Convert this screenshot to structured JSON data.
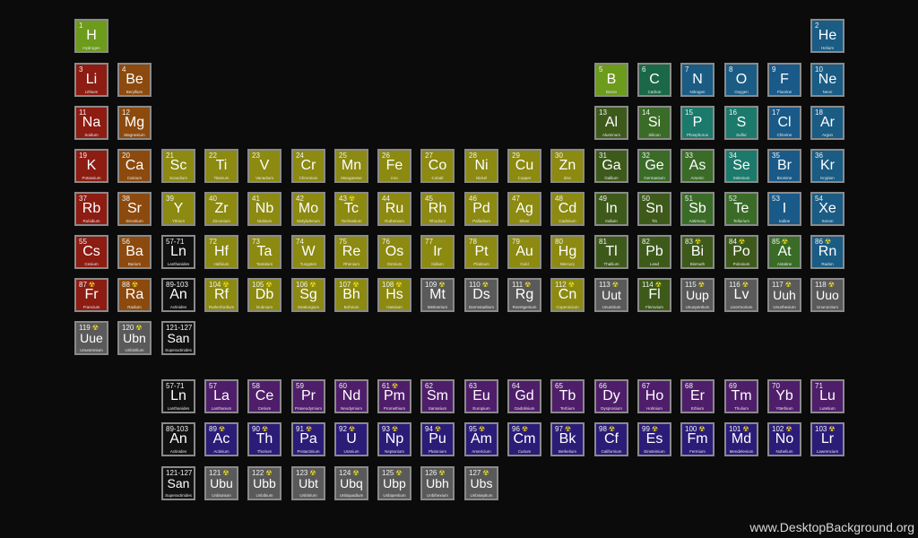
{
  "colors": {
    "nonmetal": "#6d9b1b",
    "alkali": "#8d1c12",
    "alkaline": "#8c4a0e",
    "transition": "#8c8a10",
    "posttransition": "#3e5a1b",
    "metalloid": "#3a6c28",
    "pnictogen": "#1b6848",
    "chalcogen": "#1b7a6b",
    "halogen": "#1a5a88",
    "noble": "#1a5c84",
    "lanthanide": "#4f1e6a",
    "actinide": "#2b1c78",
    "unknown": "#5a5a5a",
    "placeholder": "#111111",
    "radioactive": "#f1e21b"
  },
  "elements": [
    {
      "n": "1",
      "s": "H",
      "name": "Hydrogen",
      "c": "nonmetal",
      "col": 1,
      "row": 1
    },
    {
      "n": "2",
      "s": "He",
      "name": "Helium",
      "c": "noble",
      "col": 18,
      "row": 1
    },
    {
      "n": "3",
      "s": "Li",
      "name": "Lithium",
      "c": "alkali",
      "col": 1,
      "row": 2
    },
    {
      "n": "4",
      "s": "Be",
      "name": "Beryllium",
      "c": "alkaline",
      "col": 2,
      "row": 2
    },
    {
      "n": "5",
      "s": "B",
      "name": "Boron",
      "c": "nonmetal",
      "col": 13,
      "row": 2
    },
    {
      "n": "6",
      "s": "C",
      "name": "Carbon",
      "c": "pnictogen",
      "col": 14,
      "row": 2
    },
    {
      "n": "7",
      "s": "N",
      "name": "Nitrogen",
      "c": "noble",
      "col": 15,
      "row": 2
    },
    {
      "n": "8",
      "s": "O",
      "name": "Oxygen",
      "c": "noble",
      "col": 16,
      "row": 2
    },
    {
      "n": "9",
      "s": "F",
      "name": "Fluorine",
      "c": "halogen",
      "col": 17,
      "row": 2
    },
    {
      "n": "10",
      "s": "Ne",
      "name": "Neon",
      "c": "noble",
      "col": 18,
      "row": 2
    },
    {
      "n": "11",
      "s": "Na",
      "name": "Sodium",
      "c": "alkali",
      "col": 1,
      "row": 3
    },
    {
      "n": "12",
      "s": "Mg",
      "name": "Magnesium",
      "c": "alkaline",
      "col": 2,
      "row": 3
    },
    {
      "n": "13",
      "s": "Al",
      "name": "Aluminum",
      "c": "posttransition",
      "col": 13,
      "row": 3
    },
    {
      "n": "14",
      "s": "Si",
      "name": "Silicon",
      "c": "metalloid",
      "col": 14,
      "row": 3
    },
    {
      "n": "15",
      "s": "P",
      "name": "Phosphorus",
      "c": "chalcogen",
      "col": 15,
      "row": 3
    },
    {
      "n": "16",
      "s": "S",
      "name": "Sulfur",
      "c": "chalcogen",
      "col": 16,
      "row": 3
    },
    {
      "n": "17",
      "s": "Cl",
      "name": "Chlorine",
      "c": "halogen",
      "col": 17,
      "row": 3
    },
    {
      "n": "18",
      "s": "Ar",
      "name": "Argon",
      "c": "noble",
      "col": 18,
      "row": 3
    },
    {
      "n": "19",
      "s": "K",
      "name": "Potassium",
      "c": "alkali",
      "col": 1,
      "row": 4
    },
    {
      "n": "20",
      "s": "Ca",
      "name": "Calcium",
      "c": "alkaline",
      "col": 2,
      "row": 4
    },
    {
      "n": "21",
      "s": "Sc",
      "name": "Scandium",
      "c": "transition",
      "col": 3,
      "row": 4
    },
    {
      "n": "22",
      "s": "Ti",
      "name": "Titanium",
      "c": "transition",
      "col": 4,
      "row": 4
    },
    {
      "n": "23",
      "s": "V",
      "name": "Vanadium",
      "c": "transition",
      "col": 5,
      "row": 4
    },
    {
      "n": "24",
      "s": "Cr",
      "name": "Chromium",
      "c": "transition",
      "col": 6,
      "row": 4
    },
    {
      "n": "25",
      "s": "Mn",
      "name": "Manganese",
      "c": "transition",
      "col": 7,
      "row": 4
    },
    {
      "n": "26",
      "s": "Fe",
      "name": "Iron",
      "c": "transition",
      "col": 8,
      "row": 4
    },
    {
      "n": "27",
      "s": "Co",
      "name": "Cobalt",
      "c": "transition",
      "col": 9,
      "row": 4
    },
    {
      "n": "28",
      "s": "Ni",
      "name": "Nickel",
      "c": "transition",
      "col": 10,
      "row": 4
    },
    {
      "n": "29",
      "s": "Cu",
      "name": "Copper",
      "c": "transition",
      "col": 11,
      "row": 4
    },
    {
      "n": "30",
      "s": "Zn",
      "name": "Zinc",
      "c": "transition",
      "col": 12,
      "row": 4
    },
    {
      "n": "31",
      "s": "Ga",
      "name": "Gallium",
      "c": "posttransition",
      "col": 13,
      "row": 4
    },
    {
      "n": "32",
      "s": "Ge",
      "name": "Germanium",
      "c": "metalloid",
      "col": 14,
      "row": 4
    },
    {
      "n": "33",
      "s": "As",
      "name": "Arsenic",
      "c": "metalloid",
      "col": 15,
      "row": 4
    },
    {
      "n": "34",
      "s": "Se",
      "name": "Selenium",
      "c": "chalcogen",
      "col": 16,
      "row": 4
    },
    {
      "n": "35",
      "s": "Br",
      "name": "Bromine",
      "c": "halogen",
      "col": 17,
      "row": 4
    },
    {
      "n": "36",
      "s": "Kr",
      "name": "Krypton",
      "c": "noble",
      "col": 18,
      "row": 4
    },
    {
      "n": "37",
      "s": "Rb",
      "name": "Rubidium",
      "c": "alkali",
      "col": 1,
      "row": 5
    },
    {
      "n": "38",
      "s": "Sr",
      "name": "Strontium",
      "c": "alkaline",
      "col": 2,
      "row": 5
    },
    {
      "n": "39",
      "s": "Y",
      "name": "Yttrium",
      "c": "transition",
      "col": 3,
      "row": 5
    },
    {
      "n": "40",
      "s": "Zr",
      "name": "Zirconium",
      "c": "transition",
      "col": 4,
      "row": 5
    },
    {
      "n": "41",
      "s": "Nb",
      "name": "Niobium",
      "c": "transition",
      "col": 5,
      "row": 5
    },
    {
      "n": "42",
      "s": "Mo",
      "name": "Molybdenum",
      "c": "transition",
      "col": 6,
      "row": 5
    },
    {
      "n": "43",
      "s": "Tc",
      "name": "Technetium",
      "c": "transition",
      "col": 7,
      "row": 5,
      "rad": true
    },
    {
      "n": "44",
      "s": "Ru",
      "name": "Ruthenium",
      "c": "transition",
      "col": 8,
      "row": 5
    },
    {
      "n": "45",
      "s": "Rh",
      "name": "Rhodium",
      "c": "transition",
      "col": 9,
      "row": 5
    },
    {
      "n": "46",
      "s": "Pd",
      "name": "Palladium",
      "c": "transition",
      "col": 10,
      "row": 5
    },
    {
      "n": "47",
      "s": "Ag",
      "name": "Silver",
      "c": "transition",
      "col": 11,
      "row": 5
    },
    {
      "n": "48",
      "s": "Cd",
      "name": "Cadmium",
      "c": "transition",
      "col": 12,
      "row": 5
    },
    {
      "n": "49",
      "s": "In",
      "name": "Indium",
      "c": "posttransition",
      "col": 13,
      "row": 5
    },
    {
      "n": "50",
      "s": "Sn",
      "name": "Tin",
      "c": "posttransition",
      "col": 14,
      "row": 5
    },
    {
      "n": "51",
      "s": "Sb",
      "name": "Antimony",
      "c": "metalloid",
      "col": 15,
      "row": 5
    },
    {
      "n": "52",
      "s": "Te",
      "name": "Tellurium",
      "c": "metalloid",
      "col": 16,
      "row": 5
    },
    {
      "n": "53",
      "s": "I",
      "name": "Iodine",
      "c": "halogen",
      "col": 17,
      "row": 5
    },
    {
      "n": "54",
      "s": "Xe",
      "name": "Xenon",
      "c": "noble",
      "col": 18,
      "row": 5
    },
    {
      "n": "55",
      "s": "Cs",
      "name": "Cesium",
      "c": "alkali",
      "col": 1,
      "row": 6
    },
    {
      "n": "56",
      "s": "Ba",
      "name": "Barium",
      "c": "alkaline",
      "col": 2,
      "row": 6
    },
    {
      "n": "57-71",
      "s": "Ln",
      "name": "Lanthanides",
      "c": "placeholder",
      "col": 3,
      "row": 6
    },
    {
      "n": "72",
      "s": "Hf",
      "name": "Hafnium",
      "c": "transition",
      "col": 4,
      "row": 6
    },
    {
      "n": "73",
      "s": "Ta",
      "name": "Tantalum",
      "c": "transition",
      "col": 5,
      "row": 6
    },
    {
      "n": "74",
      "s": "W",
      "name": "Tungsten",
      "c": "transition",
      "col": 6,
      "row": 6
    },
    {
      "n": "75",
      "s": "Re",
      "name": "Rhenium",
      "c": "transition",
      "col": 7,
      "row": 6
    },
    {
      "n": "76",
      "s": "Os",
      "name": "Osmium",
      "c": "transition",
      "col": 8,
      "row": 6
    },
    {
      "n": "77",
      "s": "Ir",
      "name": "Iridium",
      "c": "transition",
      "col": 9,
      "row": 6
    },
    {
      "n": "78",
      "s": "Pt",
      "name": "Platinum",
      "c": "transition",
      "col": 10,
      "row": 6
    },
    {
      "n": "79",
      "s": "Au",
      "name": "Gold",
      "c": "transition",
      "col": 11,
      "row": 6
    },
    {
      "n": "80",
      "s": "Hg",
      "name": "Mercury",
      "c": "transition",
      "col": 12,
      "row": 6
    },
    {
      "n": "81",
      "s": "Tl",
      "name": "Thallium",
      "c": "posttransition",
      "col": 13,
      "row": 6
    },
    {
      "n": "82",
      "s": "Pb",
      "name": "Lead",
      "c": "posttransition",
      "col": 14,
      "row": 6
    },
    {
      "n": "83",
      "s": "Bi",
      "name": "Bismuth",
      "c": "posttransition",
      "col": 15,
      "row": 6,
      "rad": true
    },
    {
      "n": "84",
      "s": "Po",
      "name": "Polonium",
      "c": "posttransition",
      "col": 16,
      "row": 6,
      "rad": true
    },
    {
      "n": "85",
      "s": "At",
      "name": "Astatine",
      "c": "metalloid",
      "col": 17,
      "row": 6,
      "rad": true
    },
    {
      "n": "86",
      "s": "Rn",
      "name": "Radon",
      "c": "noble",
      "col": 18,
      "row": 6,
      "rad": true
    },
    {
      "n": "87",
      "s": "Fr",
      "name": "Francium",
      "c": "alkali",
      "col": 1,
      "row": 7,
      "rad": true
    },
    {
      "n": "88",
      "s": "Ra",
      "name": "Radium",
      "c": "alkaline",
      "col": 2,
      "row": 7,
      "rad": true
    },
    {
      "n": "89-103",
      "s": "An",
      "name": "Actinides",
      "c": "placeholder",
      "col": 3,
      "row": 7
    },
    {
      "n": "104",
      "s": "Rf",
      "name": "Rutherfordium",
      "c": "transition",
      "col": 4,
      "row": 7,
      "rad": true
    },
    {
      "n": "105",
      "s": "Db",
      "name": "Dubnium",
      "c": "transition",
      "col": 5,
      "row": 7,
      "rad": true
    },
    {
      "n": "106",
      "s": "Sg",
      "name": "Seaborgium",
      "c": "transition",
      "col": 6,
      "row": 7,
      "rad": true
    },
    {
      "n": "107",
      "s": "Bh",
      "name": "Bohrium",
      "c": "transition",
      "col": 7,
      "row": 7,
      "rad": true
    },
    {
      "n": "108",
      "s": "Hs",
      "name": "Hassium",
      "c": "transition",
      "col": 8,
      "row": 7,
      "rad": true
    },
    {
      "n": "109",
      "s": "Mt",
      "name": "Meitnerium",
      "c": "unknown",
      "col": 9,
      "row": 7,
      "rad": true
    },
    {
      "n": "110",
      "s": "Ds",
      "name": "Darmstadtium",
      "c": "unknown",
      "col": 10,
      "row": 7,
      "rad": true
    },
    {
      "n": "111",
      "s": "Rg",
      "name": "Roentgenium",
      "c": "unknown",
      "col": 11,
      "row": 7,
      "rad": true
    },
    {
      "n": "112",
      "s": "Cn",
      "name": "Copernicium",
      "c": "transition",
      "col": 12,
      "row": 7,
      "rad": true
    },
    {
      "n": "113",
      "s": "Uut",
      "name": "Ununtrium",
      "c": "unknown",
      "col": 13,
      "row": 7,
      "rad": true
    },
    {
      "n": "114",
      "s": "Fl",
      "name": "Flerovium",
      "c": "posttransition",
      "col": 14,
      "row": 7,
      "rad": true
    },
    {
      "n": "115",
      "s": "Uup",
      "name": "Ununpentium",
      "c": "unknown",
      "col": 15,
      "row": 7,
      "rad": true
    },
    {
      "n": "116",
      "s": "Lv",
      "name": "Livermorium",
      "c": "unknown",
      "col": 16,
      "row": 7,
      "rad": true
    },
    {
      "n": "117",
      "s": "Uuh",
      "name": "Ununhexium",
      "c": "unknown",
      "col": 17,
      "row": 7,
      "rad": true
    },
    {
      "n": "118",
      "s": "Uuo",
      "name": "Ununoctium",
      "c": "unknown",
      "col": 18,
      "row": 7,
      "rad": true
    },
    {
      "n": "119",
      "s": "Uue",
      "name": "Ununennium",
      "c": "unknown",
      "col": 1,
      "row": 8,
      "rad": true
    },
    {
      "n": "120",
      "s": "Ubn",
      "name": "Unbinilium",
      "c": "unknown",
      "col": 2,
      "row": 8,
      "rad": true
    },
    {
      "n": "121-127",
      "s": "San",
      "name": "Superactinides",
      "c": "placeholder",
      "col": 3,
      "row": 8
    },
    {
      "n": "57-71",
      "s": "Ln",
      "name": "Lanthanides",
      "c": "placeholder",
      "col": 3,
      "row": 10
    },
    {
      "n": "57",
      "s": "La",
      "name": "Lanthanum",
      "c": "lanthanide",
      "col": 4,
      "row": 10
    },
    {
      "n": "58",
      "s": "Ce",
      "name": "Cerium",
      "c": "lanthanide",
      "col": 5,
      "row": 10
    },
    {
      "n": "59",
      "s": "Pr",
      "name": "Praseodymium",
      "c": "lanthanide",
      "col": 6,
      "row": 10
    },
    {
      "n": "60",
      "s": "Nd",
      "name": "Neodymium",
      "c": "lanthanide",
      "col": 7,
      "row": 10
    },
    {
      "n": "61",
      "s": "Pm",
      "name": "Promethium",
      "c": "lanthanide",
      "col": 8,
      "row": 10,
      "rad": true
    },
    {
      "n": "62",
      "s": "Sm",
      "name": "Samarium",
      "c": "lanthanide",
      "col": 9,
      "row": 10
    },
    {
      "n": "63",
      "s": "Eu",
      "name": "Europium",
      "c": "lanthanide",
      "col": 10,
      "row": 10
    },
    {
      "n": "64",
      "s": "Gd",
      "name": "Gadolinium",
      "c": "lanthanide",
      "col": 11,
      "row": 10
    },
    {
      "n": "65",
      "s": "Tb",
      "name": "Terbium",
      "c": "lanthanide",
      "col": 12,
      "row": 10
    },
    {
      "n": "66",
      "s": "Dy",
      "name": "Dysprosium",
      "c": "lanthanide",
      "col": 13,
      "row": 10
    },
    {
      "n": "67",
      "s": "Ho",
      "name": "Holmium",
      "c": "lanthanide",
      "col": 14,
      "row": 10
    },
    {
      "n": "68",
      "s": "Er",
      "name": "Erbium",
      "c": "lanthanide",
      "col": 15,
      "row": 10
    },
    {
      "n": "69",
      "s": "Tm",
      "name": "Thulium",
      "c": "lanthanide",
      "col": 16,
      "row": 10
    },
    {
      "n": "70",
      "s": "Yb",
      "name": "Ytterbium",
      "c": "lanthanide",
      "col": 17,
      "row": 10
    },
    {
      "n": "71",
      "s": "Lu",
      "name": "Lutetium",
      "c": "lanthanide",
      "col": 18,
      "row": 10
    },
    {
      "n": "89-103",
      "s": "An",
      "name": "Actinides",
      "c": "placeholder",
      "col": 3,
      "row": 11
    },
    {
      "n": "89",
      "s": "Ac",
      "name": "Actinium",
      "c": "actinide",
      "col": 4,
      "row": 11,
      "rad": true
    },
    {
      "n": "90",
      "s": "Th",
      "name": "Thorium",
      "c": "actinide",
      "col": 5,
      "row": 11,
      "rad": true
    },
    {
      "n": "91",
      "s": "Pa",
      "name": "Protactinium",
      "c": "actinide",
      "col": 6,
      "row": 11,
      "rad": true
    },
    {
      "n": "92",
      "s": "U",
      "name": "Uranium",
      "c": "actinide",
      "col": 7,
      "row": 11,
      "rad": true
    },
    {
      "n": "93",
      "s": "Np",
      "name": "Neptunium",
      "c": "actinide",
      "col": 8,
      "row": 11,
      "rad": true
    },
    {
      "n": "94",
      "s": "Pu",
      "name": "Plutonium",
      "c": "actinide",
      "col": 9,
      "row": 11,
      "rad": true
    },
    {
      "n": "95",
      "s": "Am",
      "name": "Americium",
      "c": "actinide",
      "col": 10,
      "row": 11,
      "rad": true
    },
    {
      "n": "96",
      "s": "Cm",
      "name": "Curium",
      "c": "actinide",
      "col": 11,
      "row": 11,
      "rad": true
    },
    {
      "n": "97",
      "s": "Bk",
      "name": "Berkelium",
      "c": "actinide",
      "col": 12,
      "row": 11,
      "rad": true
    },
    {
      "n": "98",
      "s": "Cf",
      "name": "Californium",
      "c": "actinide",
      "col": 13,
      "row": 11,
      "rad": true
    },
    {
      "n": "99",
      "s": "Es",
      "name": "Einsteinium",
      "c": "actinide",
      "col": 14,
      "row": 11,
      "rad": true
    },
    {
      "n": "100",
      "s": "Fm",
      "name": "Fermium",
      "c": "actinide",
      "col": 15,
      "row": 11,
      "rad": true
    },
    {
      "n": "101",
      "s": "Md",
      "name": "Mendelevium",
      "c": "actinide",
      "col": 16,
      "row": 11,
      "rad": true
    },
    {
      "n": "102",
      "s": "No",
      "name": "Nobelium",
      "c": "actinide",
      "col": 17,
      "row": 11,
      "rad": true
    },
    {
      "n": "103",
      "s": "Lr",
      "name": "Lawrencium",
      "c": "actinide",
      "col": 18,
      "row": 11,
      "rad": true
    },
    {
      "n": "121-127",
      "s": "San",
      "name": "Superactinides",
      "c": "placeholder",
      "col": 3,
      "row": 12
    },
    {
      "n": "121",
      "s": "Ubu",
      "name": "Unbiunium",
      "c": "unknown",
      "col": 4,
      "row": 12,
      "rad": true
    },
    {
      "n": "122",
      "s": "Ubb",
      "name": "Unbibium",
      "c": "unknown",
      "col": 5,
      "row": 12,
      "rad": true
    },
    {
      "n": "123",
      "s": "Ubt",
      "name": "Unbitrium",
      "c": "unknown",
      "col": 6,
      "row": 12,
      "rad": true
    },
    {
      "n": "124",
      "s": "Ubq",
      "name": "Unbiquadium",
      "c": "unknown",
      "col": 7,
      "row": 12,
      "rad": true
    },
    {
      "n": "125",
      "s": "Ubp",
      "name": "Unbipentium",
      "c": "unknown",
      "col": 8,
      "row": 12,
      "rad": true
    },
    {
      "n": "126",
      "s": "Ubh",
      "name": "Unbihexium",
      "c": "unknown",
      "col": 9,
      "row": 12,
      "rad": true
    },
    {
      "n": "127",
      "s": "Ubs",
      "name": "Unbiseptium",
      "c": "unknown",
      "col": 10,
      "row": 12,
      "rad": true
    }
  ],
  "watermark": "www.DesktopBackground.org"
}
